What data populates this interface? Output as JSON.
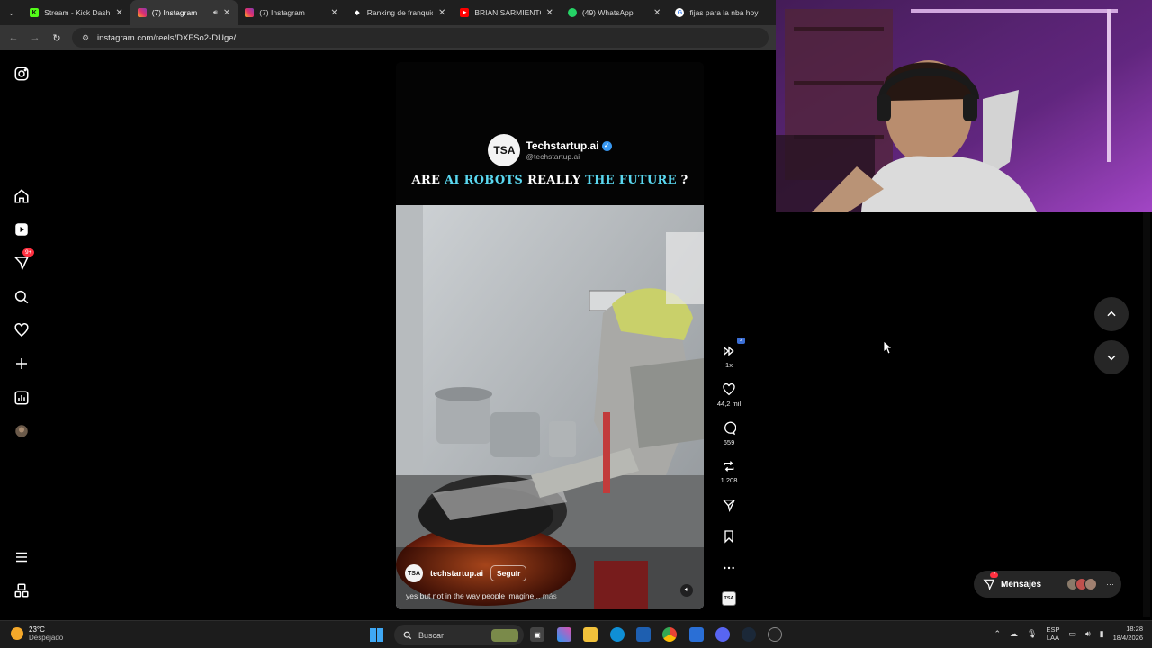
{
  "browser": {
    "tabs": [
      {
        "title": "Stream - Kick Dashboard",
        "favicon_color": "#53fc18",
        "favicon_letter": "K",
        "active": false
      },
      {
        "title": "(7) Instagram",
        "favicon_color": "#e1306c",
        "favicon_letter": "",
        "active": true
      },
      {
        "title": "(7) Instagram",
        "favicon_color": "#e1306c",
        "favicon_letter": "",
        "active": false
      },
      {
        "title": "Ranking de franquicias",
        "favicon_color": "#ffffff",
        "favicon_letter": "",
        "active": false
      },
      {
        "title": "BRIAN SARMIENTO y",
        "favicon_color": "#ff0000",
        "favicon_letter": "",
        "active": false
      },
      {
        "title": "(49) WhatsApp",
        "favicon_color": "#25d366",
        "favicon_letter": "",
        "active": false
      },
      {
        "title": "fijas para la nba hoy",
        "favicon_color": "#4285f4",
        "favicon_letter": "G",
        "active": false
      }
    ],
    "url": "instagram.com/reels/DXFSo2-DUge/"
  },
  "instagram": {
    "notifications_badge": "9+",
    "reel": {
      "brand_name": "Techstartup.ai",
      "brand_handle": "@techstartup.ai",
      "brand_logo": "TSA",
      "headline": {
        "part1": "ARE ",
        "part2": "AI ROBOTS",
        "part3": " REALLY ",
        "part4": "THE FUTURE",
        "part5": " ?"
      },
      "username": "techstartup.ai",
      "follow_label": "Seguir",
      "caption": "yes but not in the way people imagine...",
      "caption_more": " más"
    },
    "actions": {
      "speed": "1x",
      "speed_badge": "2",
      "likes": "44,2 mil",
      "comments": "659",
      "reposts": "1.208"
    },
    "messages": {
      "label": "Mensajes",
      "badge": "7",
      "more": "···"
    }
  },
  "taskbar": {
    "weather_temp": "23°C",
    "weather_desc": "Despejado",
    "search_placeholder": "Buscar",
    "lang_line1": "ESP",
    "lang_line2": "LAA",
    "time": "18:28",
    "date": "18/4/2026"
  }
}
